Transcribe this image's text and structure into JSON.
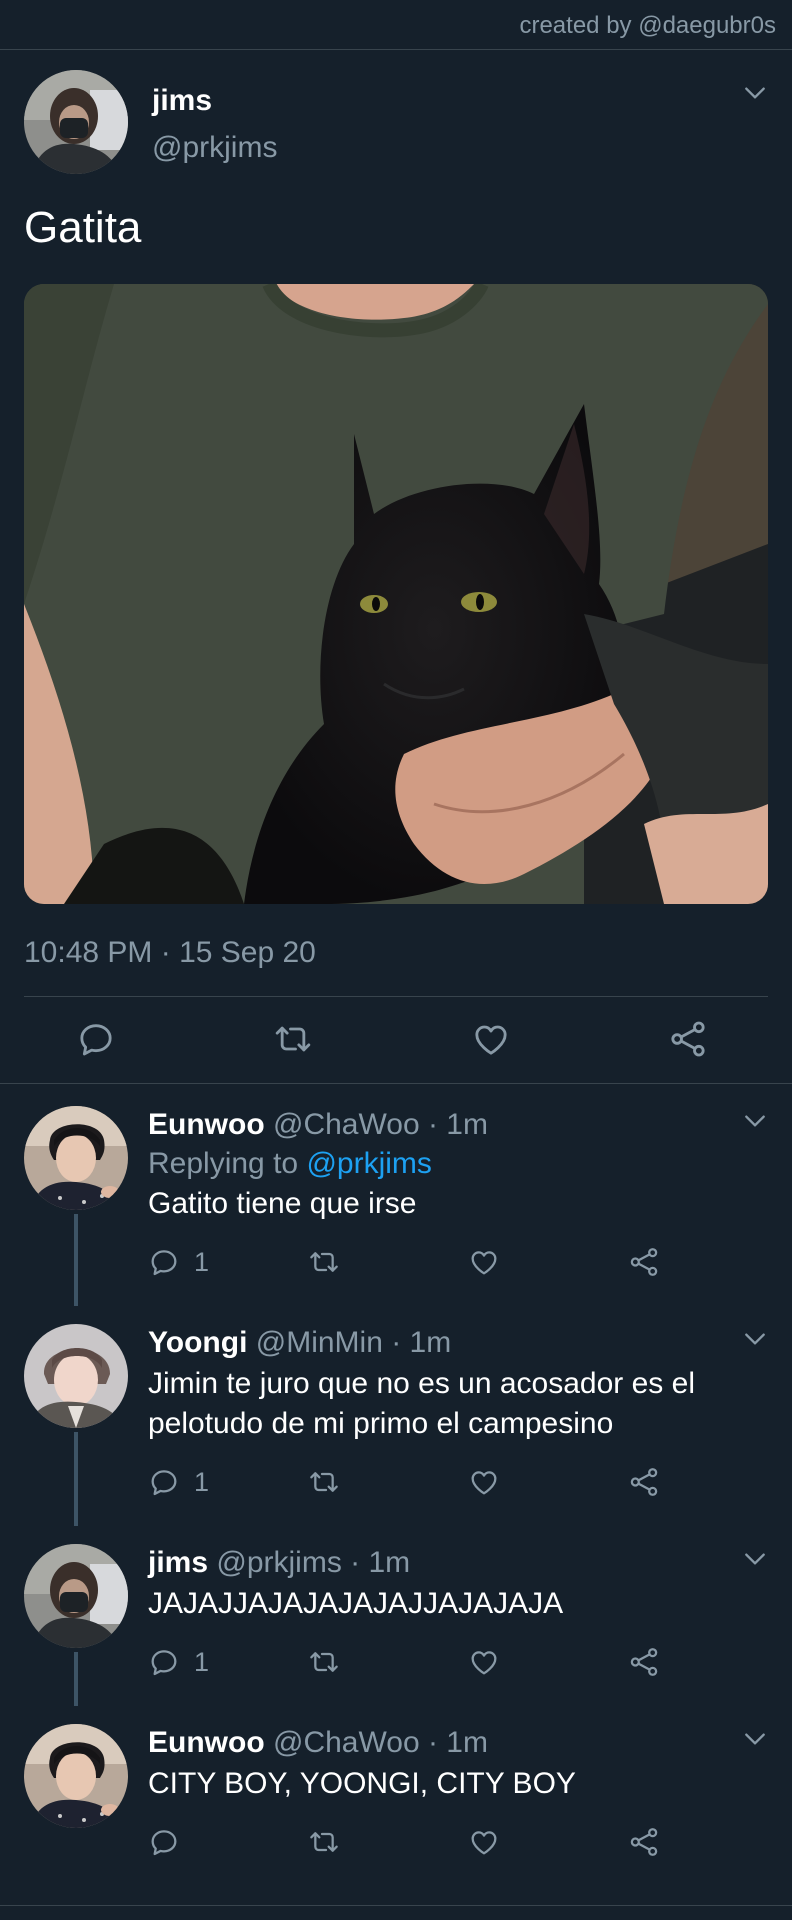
{
  "credit": "created by @daegubr0s",
  "main_tweet": {
    "name": "jims",
    "handle": "@prkjims",
    "text": "Gatita",
    "timestamp": "10:48 PM · 15 Sep 20",
    "actions": [
      "reply-icon",
      "retweet-icon",
      "like-icon",
      "share-icon"
    ]
  },
  "replies": [
    {
      "name": "Eunwoo",
      "meta": "@ChaWoo · 1m",
      "replying_prefix": "Replying to ",
      "replying_handle": "@prkjims",
      "text": "Gatito tiene que irse",
      "reply_count": "1"
    },
    {
      "name": "Yoongi",
      "meta": "@MinMin · 1m",
      "text": "Jimin te juro que no es un acosador es el pelotudo de mi primo el campesino",
      "reply_count": "1"
    },
    {
      "name": "jims",
      "meta": "@prkjims · 1m",
      "text": "JAJAJJAJAJAJAJAJJAJAJAJA",
      "reply_count": "1"
    },
    {
      "name": "Eunwoo",
      "meta": "@ChaWoo · 1m",
      "text": "CITY BOY, YOONGI, CITY BOY",
      "reply_count": ""
    }
  ],
  "colors": {
    "background": "#15202b",
    "secondary_text": "#8899a6",
    "link": "#1da1f2",
    "divider": "#38444d"
  }
}
